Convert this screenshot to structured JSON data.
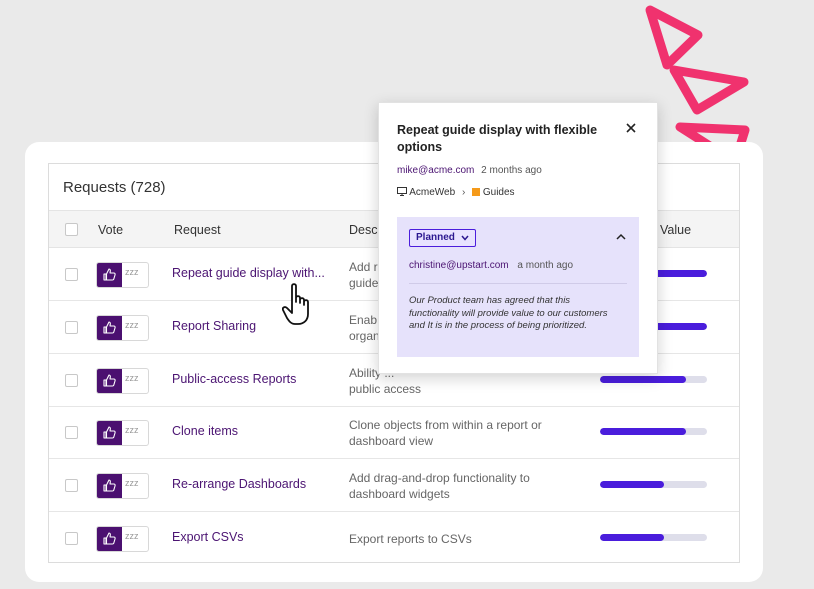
{
  "panel": {
    "title": "Requests (728)"
  },
  "columns": {
    "vote": "Vote",
    "request": "Request",
    "description": "Desc",
    "value": "Value"
  },
  "vote": {
    "snooze_label": "zzz"
  },
  "rows": [
    {
      "request": "Repeat guide display with...",
      "description": "Add r\nguide",
      "value": 1.0
    },
    {
      "request": "Report Sharing",
      "description": "Enab\norgan",
      "value": 1.0
    },
    {
      "request": "Public-access Reports",
      "description": "Ability ...\npublic access",
      "value": 0.8
    },
    {
      "request": "Clone items",
      "description": "Clone objects from within a report or\ndashboard view",
      "value": 0.8
    },
    {
      "request": "Re-arrange Dashboards",
      "description": "Add drag-and-drop functionality to\ndashboard widgets",
      "value": 0.6
    },
    {
      "request": "Export CSVs",
      "description": "Export reports to CSVs",
      "value": 0.6
    }
  ],
  "popup": {
    "title": "Repeat guide display with flexible options",
    "author": "mike@acme.com",
    "time": "2 months ago",
    "crumb_app": "AcmeWeb",
    "crumb_area": "Guides",
    "status": "Planned",
    "reply_author": "christine@upstart.com",
    "reply_time": "a month ago",
    "reply_text": "Our Product team has agreed that this functionality will provide value to our customers and It is in the process of being prioritized."
  },
  "colors": {
    "brand_purple": "#4b1070",
    "accent_blue": "#4a1ddc",
    "guides_orange": "#f59a1a",
    "decor_pink": "#f0326e"
  }
}
